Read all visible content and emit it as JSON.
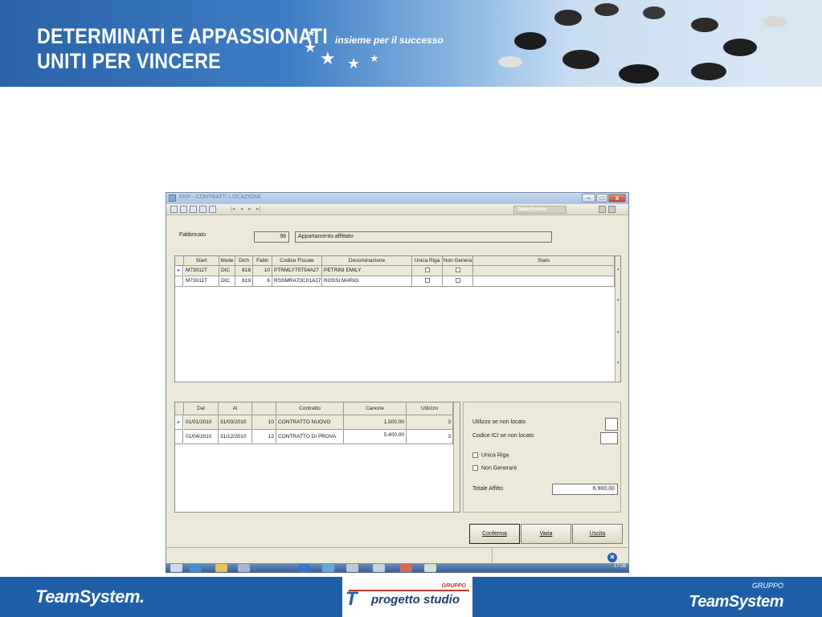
{
  "banner": {
    "headline_line1": "DETERMINATI E APPASSIONATI",
    "headline_line2": "UNITI PER VINCERE",
    "slogan": "insieme per il successo"
  },
  "window": {
    "title": "ERP - CONTRATTI LOCAZIONE",
    "brand": "TeamSystem",
    "minimize": "–",
    "maximize": "□",
    "close": "x",
    "nav": [
      "|◂",
      "◂",
      "▸",
      "▸|"
    ]
  },
  "fabbricato": {
    "label": "Fabbricato",
    "number": "98",
    "description": "Appartamento affittato"
  },
  "tenants_grid": {
    "columns": [
      "Start",
      "Mode",
      "Dich",
      "Fabb",
      "Codice Fiscale",
      "Denominazione",
      "Unica Riga",
      "Non Genera",
      "Stato"
    ],
    "rows": [
      {
        "start": "M73011T",
        "mode": "DIC",
        "dich": "618",
        "fabb": "10",
        "cf": "PTRMLY75T54A27",
        "den": "PETRINI EMILY",
        "stato": ""
      },
      {
        "start": "M73011T",
        "mode": "DIC",
        "dich": "619",
        "fabb": "6",
        "cf": "RSSMRA70C01A27",
        "den": "ROSSI MARIO",
        "stato": ""
      }
    ]
  },
  "contracts_grid": {
    "columns": [
      "Dal",
      "Al",
      "",
      "Contratto",
      "Canone",
      "Utilizzo"
    ],
    "rows": [
      {
        "dal": "01/01/2010",
        "al": "31/03/2010",
        "num": "10",
        "contratto": "CONTRATTO NUOVO",
        "canone": "1.500,00",
        "utilizzo": "3"
      },
      {
        "dal": "01/04/2010",
        "al": "31/12/2010",
        "num": "12",
        "contratto": "CONTRATTO DI PROVA",
        "canone": "5.400,00",
        "utilizzo": "3"
      }
    ]
  },
  "side_panel": {
    "utilizzo_label": "Utilizzo se non locato",
    "codice_ici_label": "Codice ICI se non locato",
    "unica_riga_label": "Unica Riga",
    "non_generare_label": "Non Generare",
    "totale_label": "Totale Affitto",
    "totale_value": "6.900,00"
  },
  "buttons": {
    "conferma": "Conferma",
    "varia": "Varia",
    "uscita": "Uscita"
  },
  "taskbar": {
    "clock": "17:08"
  },
  "footer": {
    "left_logo": "TeamSystem.",
    "center_gruppo": "GRUPPO",
    "center_mark": "T",
    "center_name": "progetto studio",
    "right_gruppo": "GRUPPO",
    "right_logo": "TeamSystem"
  },
  "colors": {
    "banner_blue": "#2a63a8",
    "footer_blue": "#1f5fa8",
    "window_bg": "#ece9d8"
  }
}
